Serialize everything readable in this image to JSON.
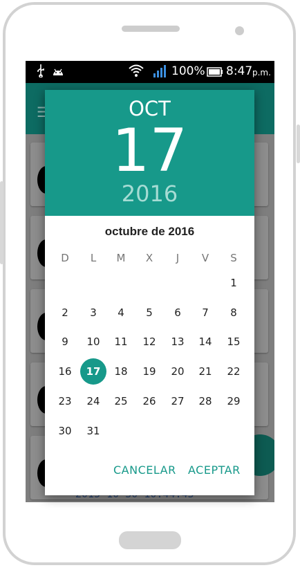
{
  "status_bar": {
    "usb_icon": "usb-icon",
    "android_icon": "android-icon",
    "wifi_icon": "wifi-icon",
    "signal_icon": "signal-icon",
    "battery_pct": "100%",
    "battery_icon": "battery-icon",
    "time": "8:47",
    "ampm": "p.m."
  },
  "background": {
    "fragment_text": "2015-10-30 10:44:43"
  },
  "dialog": {
    "header": {
      "month": "OCT",
      "day": "17",
      "year": "2016"
    },
    "calendar_title": "octubre de 2016",
    "weekdays": [
      "D",
      "L",
      "M",
      "X",
      "J",
      "V",
      "S"
    ],
    "weeks": [
      [
        "",
        "",
        "",
        "",
        "",
        "",
        "1"
      ],
      [
        "2",
        "3",
        "4",
        "5",
        "6",
        "7",
        "8"
      ],
      [
        "9",
        "10",
        "11",
        "12",
        "13",
        "14",
        "15"
      ],
      [
        "16",
        "17",
        "18",
        "19",
        "20",
        "21",
        "22"
      ],
      [
        "23",
        "24",
        "25",
        "26",
        "27",
        "28",
        "29"
      ],
      [
        "30",
        "31",
        "",
        "",
        "",
        "",
        ""
      ]
    ],
    "selected_day": "17",
    "cancel_label": "CANCELAR",
    "accept_label": "ACEPTAR"
  },
  "colors": {
    "accent": "#17998a",
    "app_bar": "#0d6b62",
    "year_text": "#a6dcd4"
  }
}
